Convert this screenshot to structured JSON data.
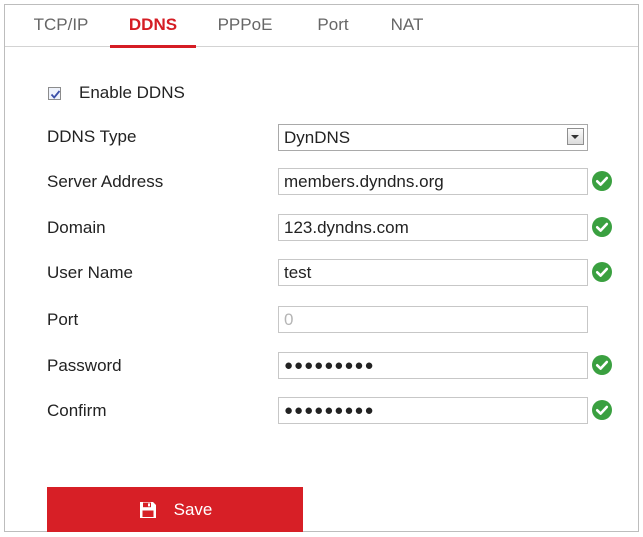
{
  "tabs": [
    {
      "label": "TCP/IP",
      "active": false
    },
    {
      "label": "DDNS",
      "active": true
    },
    {
      "label": "PPPoE",
      "active": false
    },
    {
      "label": "Port",
      "active": false
    },
    {
      "label": "NAT",
      "active": false
    }
  ],
  "enable_ddns": {
    "label": "Enable DDNS",
    "checked": true
  },
  "ddns_type": {
    "label": "DDNS Type",
    "value": "DynDNS"
  },
  "server_address": {
    "label": "Server Address",
    "value": "members.dyndns.org",
    "valid": true
  },
  "domain": {
    "label": "Domain",
    "value": "123.dyndns.com",
    "valid": true
  },
  "user_name": {
    "label": "User Name",
    "value": "test",
    "valid": true
  },
  "port": {
    "label": "Port",
    "value": "0",
    "disabled": true
  },
  "password": {
    "label": "Password",
    "value": "●●●●●●●●●",
    "valid": true
  },
  "confirm": {
    "label": "Confirm",
    "value": "●●●●●●●●●",
    "valid": true
  },
  "save_button": {
    "label": "Save"
  },
  "colors": {
    "accent": "#d71f26",
    "valid": "#3aa040"
  },
  "icons": {
    "save": "floppy-disk-icon",
    "valid": "check-circle-icon",
    "dropdown": "chevron-down-icon"
  }
}
